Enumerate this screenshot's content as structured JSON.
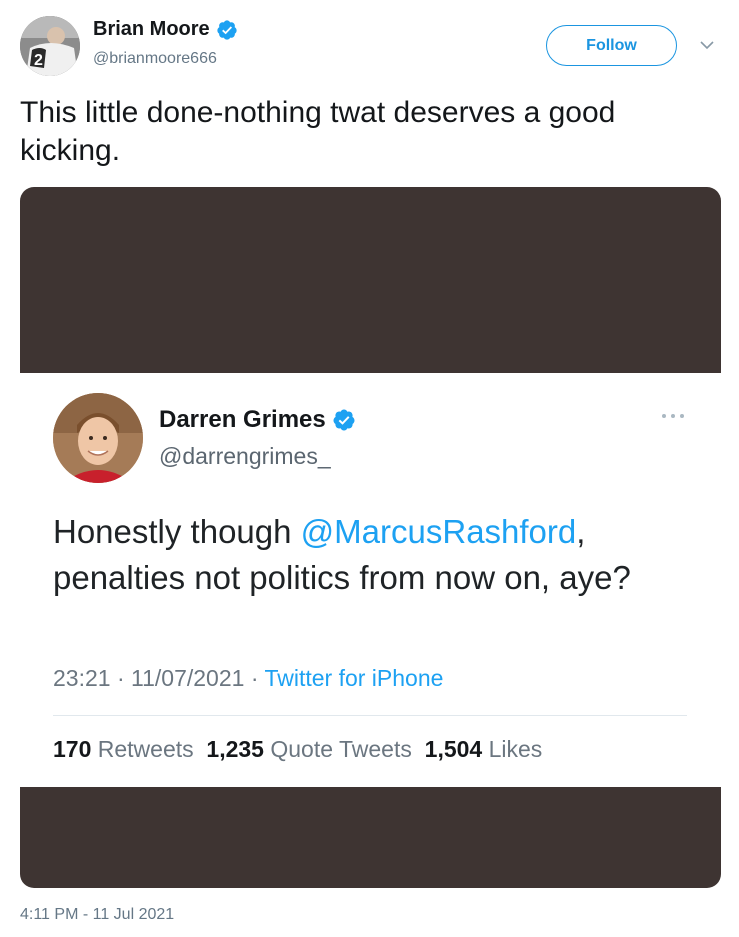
{
  "author": {
    "display_name": "Brian Moore",
    "handle": "@brianmoore666",
    "verified": true,
    "avatar_icon": "avatar-photo-icon"
  },
  "actions": {
    "follow_label": "Follow",
    "caret_icon": "chevron-down-icon"
  },
  "tweet": {
    "text": "This little done-nothing twat deserves a good kicking.",
    "timestamp": "4:11 PM - 11 Jul 2021"
  },
  "quoted_screenshot": {
    "display_name": "Darren Grimes",
    "handle": "@darrengrimes_",
    "verified": true,
    "text_before_mention": "Honestly though ",
    "mention": "@MarcusRashford",
    "text_after_mention": ", penalties not politics from now on, aye?",
    "time": "23:21",
    "date": "11/07/2021",
    "source": "Twitter for iPhone",
    "stats": {
      "retweets_count": "170",
      "retweets_label": "Retweets",
      "quote_count": "1,235",
      "quote_label": "Quote Tweets",
      "likes_count": "1,504",
      "likes_label": "Likes"
    }
  },
  "colors": {
    "accent": "#1b95e0",
    "verified_badge": "#1da1f2",
    "media_background": "#3e3432",
    "secondary_text": "#657786"
  }
}
